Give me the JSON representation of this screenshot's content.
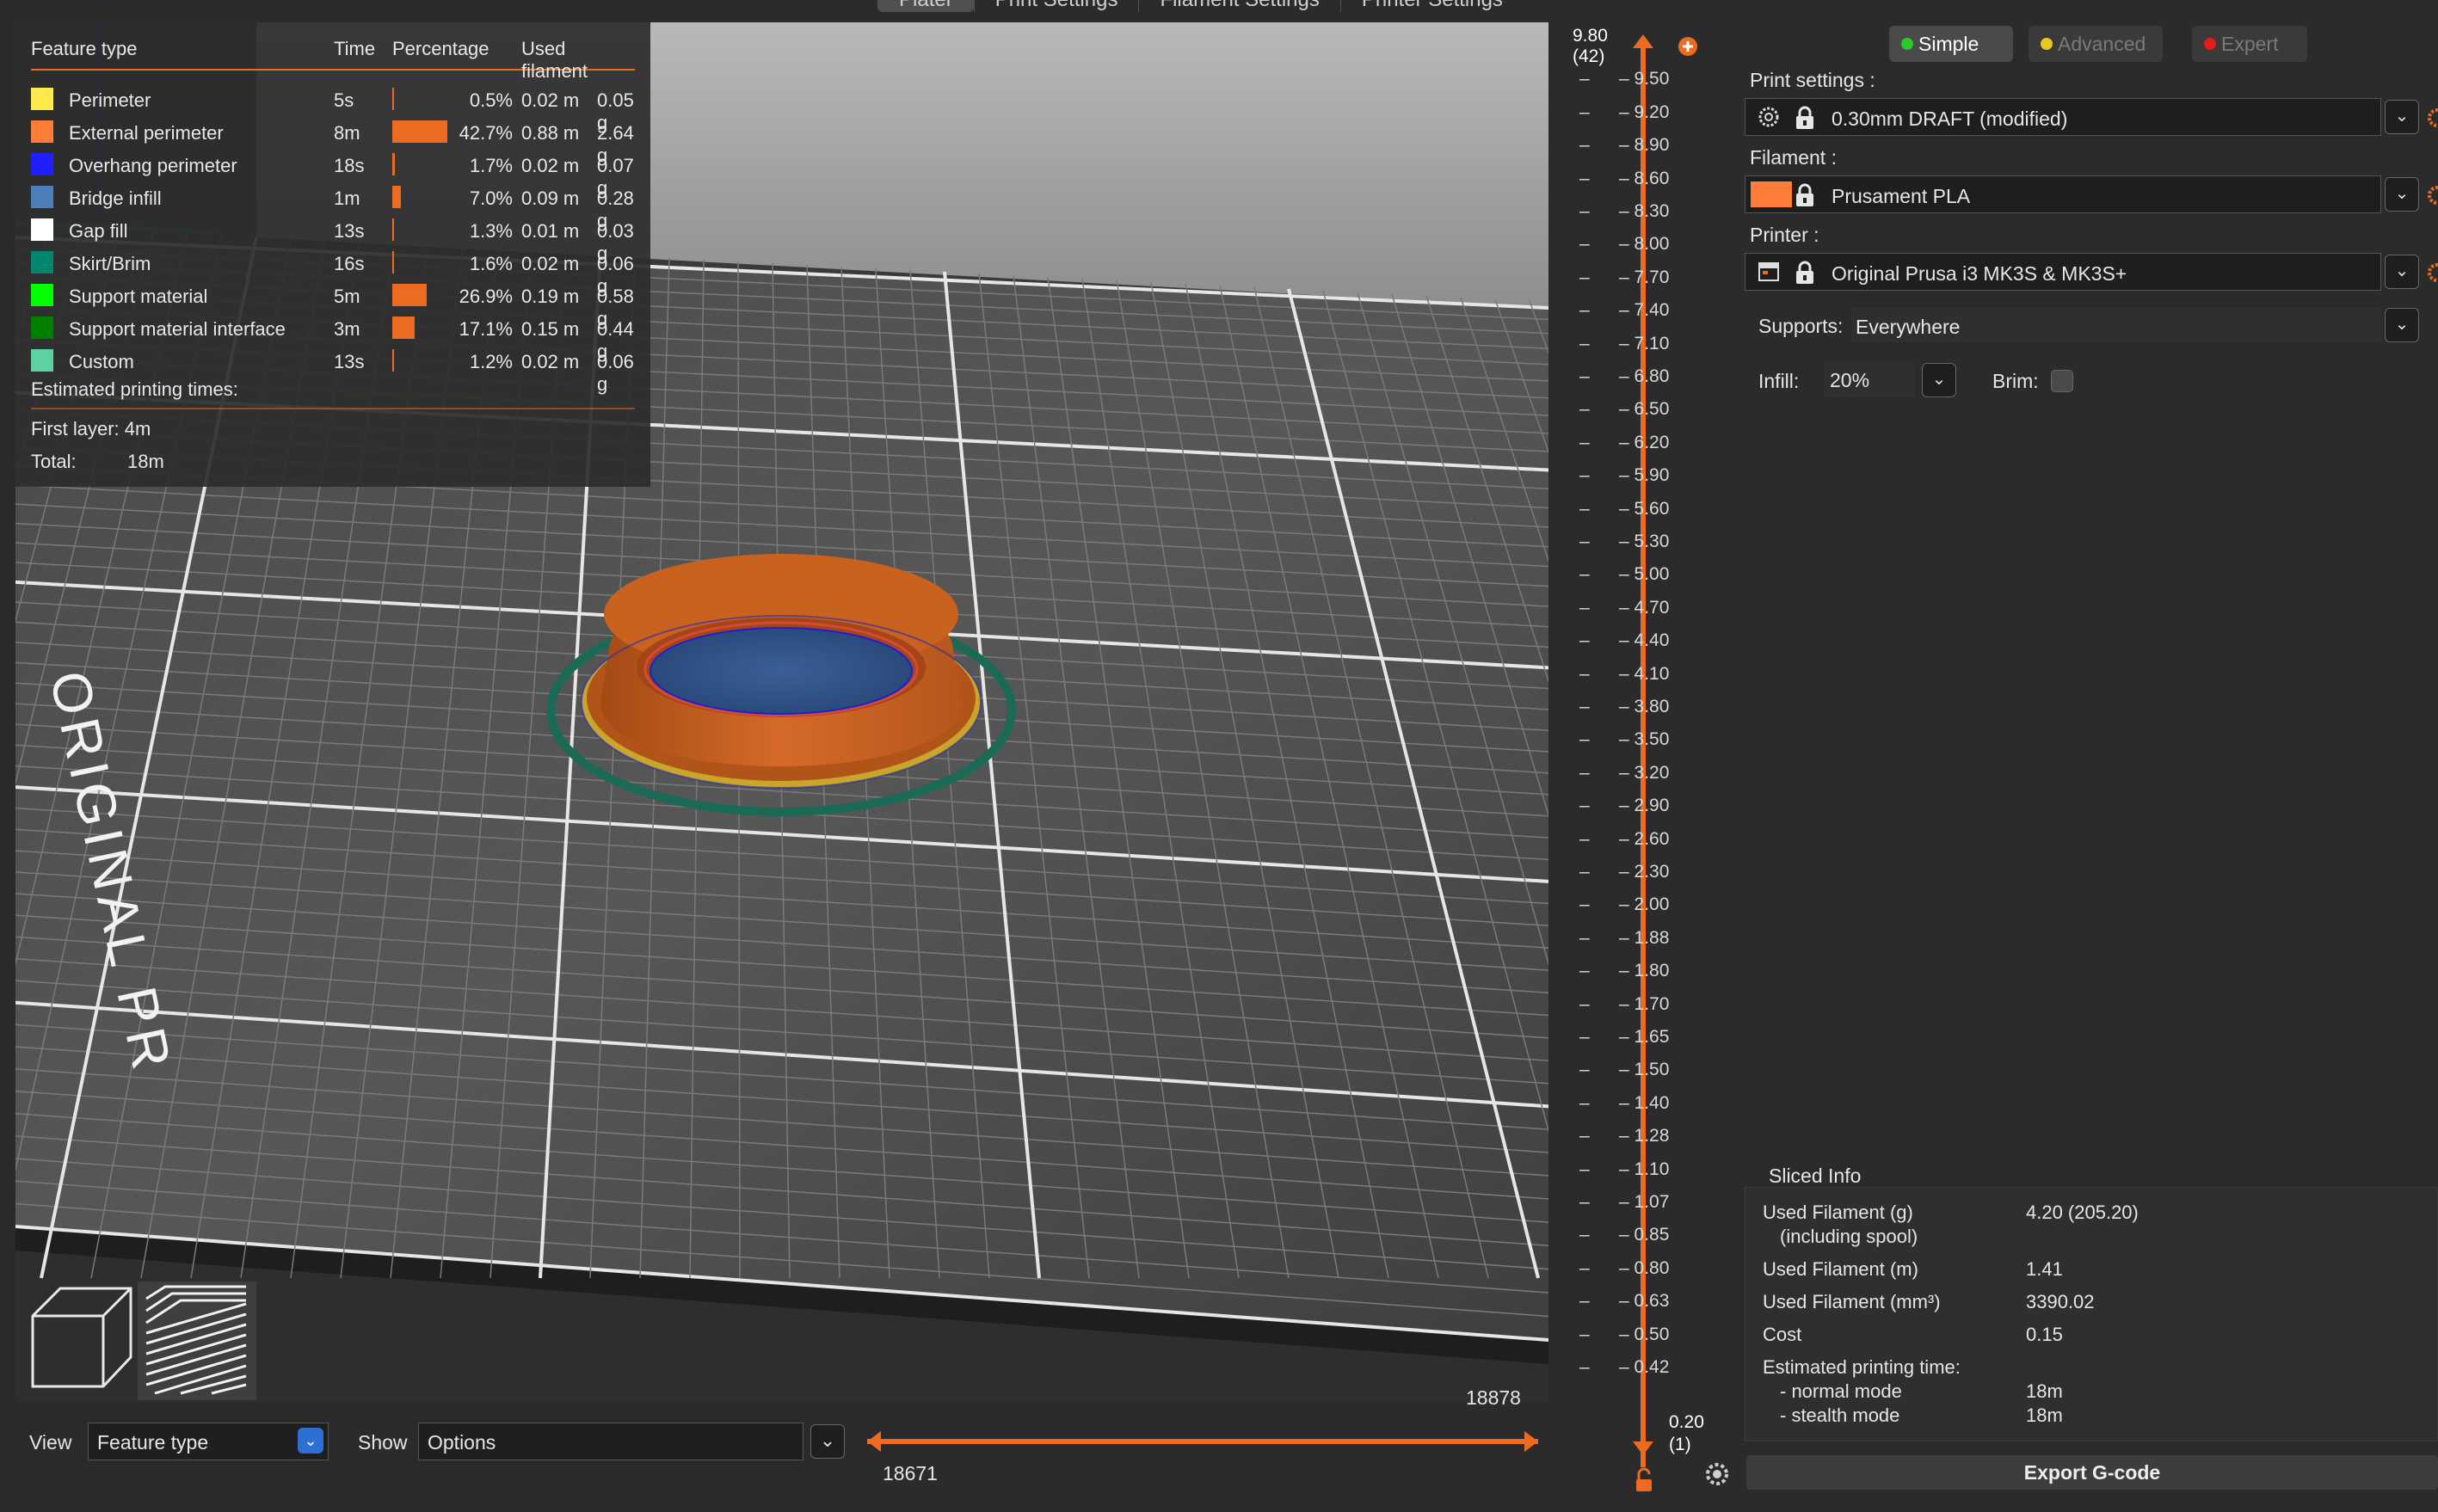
{
  "tabs": [
    "Plater",
    "Print Settings",
    "Filament Settings",
    "Printer Settings"
  ],
  "bed_text": "ORIGINAL PR",
  "legend": {
    "headers": {
      "feature": "Feature type",
      "time": "Time",
      "percentage": "Percentage",
      "used": "Used filament"
    },
    "rows": [
      {
        "name": "Perimeter",
        "color": "#ffe94d",
        "time": "5s",
        "pct_value": 0.5,
        "pct": "0.5%",
        "len": "0.02 m",
        "wt": "0.05 g"
      },
      {
        "name": "External perimeter",
        "color": "#ff7d38",
        "time": "8m",
        "pct_value": 42.7,
        "pct": "42.7%",
        "len": "0.88 m",
        "wt": "2.64 g"
      },
      {
        "name": "Overhang perimeter",
        "color": "#1f1fff",
        "time": "18s",
        "pct_value": 1.7,
        "pct": "1.7%",
        "len": "0.02 m",
        "wt": "0.07 g"
      },
      {
        "name": "Bridge infill",
        "color": "#4d80ba",
        "time": "1m",
        "pct_value": 7.0,
        "pct": "7.0%",
        "len": "0.09 m",
        "wt": "0.28 g"
      },
      {
        "name": "Gap fill",
        "color": "#ffffff",
        "time": "13s",
        "pct_value": 1.3,
        "pct": "1.3%",
        "len": "0.01 m",
        "wt": "0.03 g"
      },
      {
        "name": "Skirt/Brim",
        "color": "#00876e",
        "time": "16s",
        "pct_value": 1.6,
        "pct": "1.6%",
        "len": "0.02 m",
        "wt": "0.06 g"
      },
      {
        "name": "Support material",
        "color": "#00ff00",
        "time": "5m",
        "pct_value": 26.9,
        "pct": "26.9%",
        "len": "0.19 m",
        "wt": "0.58 g"
      },
      {
        "name": "Support material interface",
        "color": "#008000",
        "time": "3m",
        "pct_value": 17.1,
        "pct": "17.1%",
        "len": "0.15 m",
        "wt": "0.44 g"
      },
      {
        "name": "Custom",
        "color": "#5ed1a1",
        "time": "13s",
        "pct_value": 1.2,
        "pct": "1.2%",
        "len": "0.02 m",
        "wt": "0.06 g"
      }
    ],
    "est_label": "Estimated printing times:",
    "first_layer": "First layer: 4m",
    "total_label": "Total:",
    "total_value": "18m"
  },
  "bottom": {
    "view_label": "View",
    "view_value": "Feature type",
    "show_label": "Show",
    "show_value": "Options",
    "hslider_top": "18878",
    "hslider_bottom": "18671",
    "hslider_low": 0.0,
    "hslider_high": 1.0
  },
  "vslider": {
    "top_value": "9.80",
    "top_layer": "(42)",
    "bottom_value": "0.20",
    "bottom_layer": "(1)",
    "ticks": [
      "9.80",
      "9.50",
      "9.20",
      "8.90",
      "8.60",
      "8.30",
      "8.00",
      "7.70",
      "7.40",
      "7.10",
      "6.80",
      "6.50",
      "6.20",
      "5.90",
      "5.60",
      "5.30",
      "5.00",
      "4.70",
      "4.40",
      "4.10",
      "3.80",
      "3.50",
      "3.20",
      "2.90",
      "2.60",
      "2.30",
      "2.00",
      "1.88",
      "1.80",
      "1.70",
      "1.65",
      "1.50",
      "1.40",
      "1.28",
      "1.10",
      "1.07",
      "0.85",
      "0.80",
      "0.63",
      "0.50",
      "0.42"
    ]
  },
  "panel": {
    "modes": {
      "simple": "Simple",
      "advanced": "Advanced",
      "expert": "Expert"
    },
    "mode_colors": {
      "simple": "#2ac92a",
      "advanced": "#e8c61b",
      "expert": "#e31b1b"
    },
    "print_settings_label": "Print settings :",
    "print_settings_value": "0.30mm DRAFT (modified)",
    "filament_label": "Filament :",
    "filament_value": "Prusament PLA",
    "filament_color": "#ff7d38",
    "printer_label": "Printer :",
    "printer_value": "Original Prusa i3 MK3S & MK3S+",
    "supports_label": "Supports:",
    "supports_value": "Everywhere",
    "infill_label": "Infill:",
    "infill_value": "20%",
    "brim_label": "Brim:",
    "brim_checked": false
  },
  "sliced": {
    "title": "Sliced Info",
    "used_g_label": "Used Filament (g)",
    "used_g_sub": "(including spool)",
    "used_g_value": "4.20 (205.20)",
    "used_m_label": "Used Filament (m)",
    "used_m_value": "1.41",
    "used_mm3_label": "Used Filament (mm³)",
    "used_mm3_value": "3390.02",
    "cost_label": "Cost",
    "cost_value": "0.15",
    "est_label": "Estimated printing time:",
    "normal_label": "- normal mode",
    "normal_value": "18m",
    "stealth_label": "- stealth mode",
    "stealth_value": "18m"
  },
  "export_label": "Export G-code",
  "accent": "#ed6b21"
}
